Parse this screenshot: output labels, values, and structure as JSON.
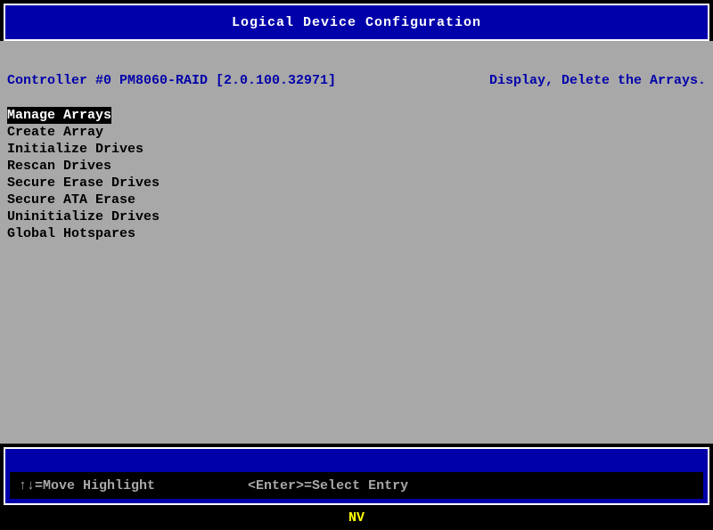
{
  "header": {
    "title": "Logical Device Configuration"
  },
  "controller": {
    "label": "Controller #0 PM8060-RAID [2.0.100.32971]",
    "hint": "Display, Delete the Arrays."
  },
  "menu": {
    "items": [
      {
        "label": "Manage Arrays",
        "selected": true
      },
      {
        "label": "Create Array",
        "selected": false
      },
      {
        "label": "Initialize Drives",
        "selected": false
      },
      {
        "label": "Rescan Drives",
        "selected": false
      },
      {
        "label": "Secure Erase Drives",
        "selected": false
      },
      {
        "label": "Secure ATA Erase",
        "selected": false
      },
      {
        "label": "Uninitialize Drives",
        "selected": false
      },
      {
        "label": "Global Hotspares",
        "selected": false
      }
    ]
  },
  "help": {
    "move": "↑↓=Move Highlight",
    "select": "<Enter>=Select Entry"
  },
  "footer": {
    "status": "NV"
  }
}
